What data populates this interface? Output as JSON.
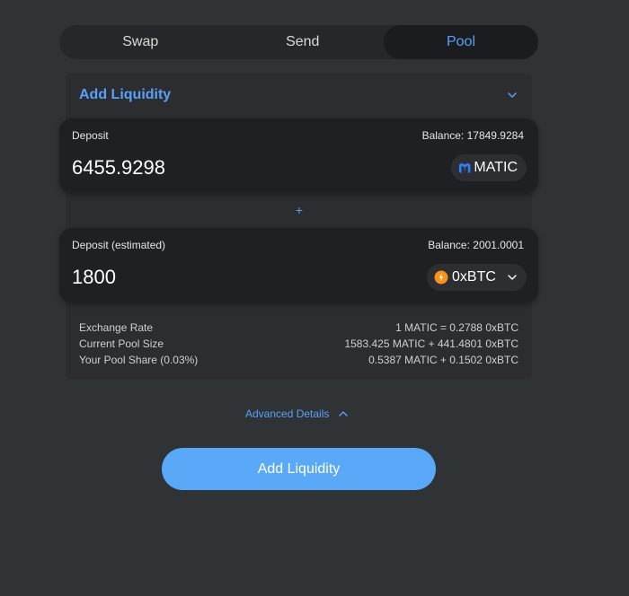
{
  "tabs": [
    {
      "label": "Swap",
      "active": false
    },
    {
      "label": "Send",
      "active": false
    },
    {
      "label": "Pool",
      "active": true
    }
  ],
  "panel": {
    "title": "Add Liquidity"
  },
  "deposit": {
    "label": "Deposit",
    "balance": "Balance: 17849.9284",
    "amount": "6455.9298",
    "token": "MATIC",
    "token_icon": "matic-icon"
  },
  "plus_symbol": "+",
  "deposit_estimated": {
    "label": "Deposit (estimated)",
    "balance": "Balance: 2001.0001",
    "amount": "1800",
    "token": "0xBTC",
    "token_icon": "0xbtc-icon"
  },
  "info": [
    {
      "label": "Exchange Rate",
      "value": "1 MATIC = 0.2788 0xBTC"
    },
    {
      "label": "Current Pool Size",
      "value": "1583.425 MATIC + 441.4801 0xBTC"
    },
    {
      "label": "Your Pool Share (0.03%)",
      "value": "0.5387 MATIC + 0.1502 0xBTC"
    }
  ],
  "advanced_label": "Advanced Details",
  "cta_label": "Add Liquidity",
  "colors": {
    "accent": "#5aa0f7",
    "button": "#5aa8f8",
    "background": "#303336",
    "card": "#1e2023",
    "btc_orange": "#f7931a",
    "matic_blue": "#2f7cf0"
  }
}
